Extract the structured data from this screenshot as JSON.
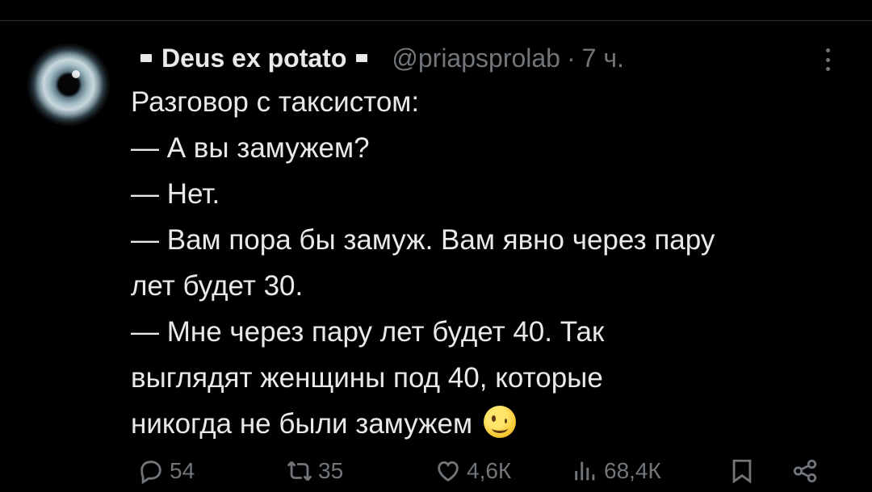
{
  "tweet": {
    "author_name": "Deus ex potato",
    "handle": "@priapsprolab",
    "separator": "·",
    "time": "7 ч.",
    "lines": [
      "Разговор с таксистом:",
      "— А вы замужем?",
      "— Нет.",
      "— Вам пора бы замуж. Вам явно через пару",
      "лет будет 30.",
      "— Мне через пару лет будет 40. Так",
      "выглядят женщины под 40, которые",
      "никогда не были замужем"
    ],
    "emoji": "winking-face"
  },
  "actions": {
    "replies": "54",
    "retweets": "35",
    "likes": "4,6К",
    "views": "68,4К"
  },
  "colors": {
    "background": "#000000",
    "text": "#e7e9ea",
    "muted": "#71767b",
    "divider": "#2f3336"
  }
}
